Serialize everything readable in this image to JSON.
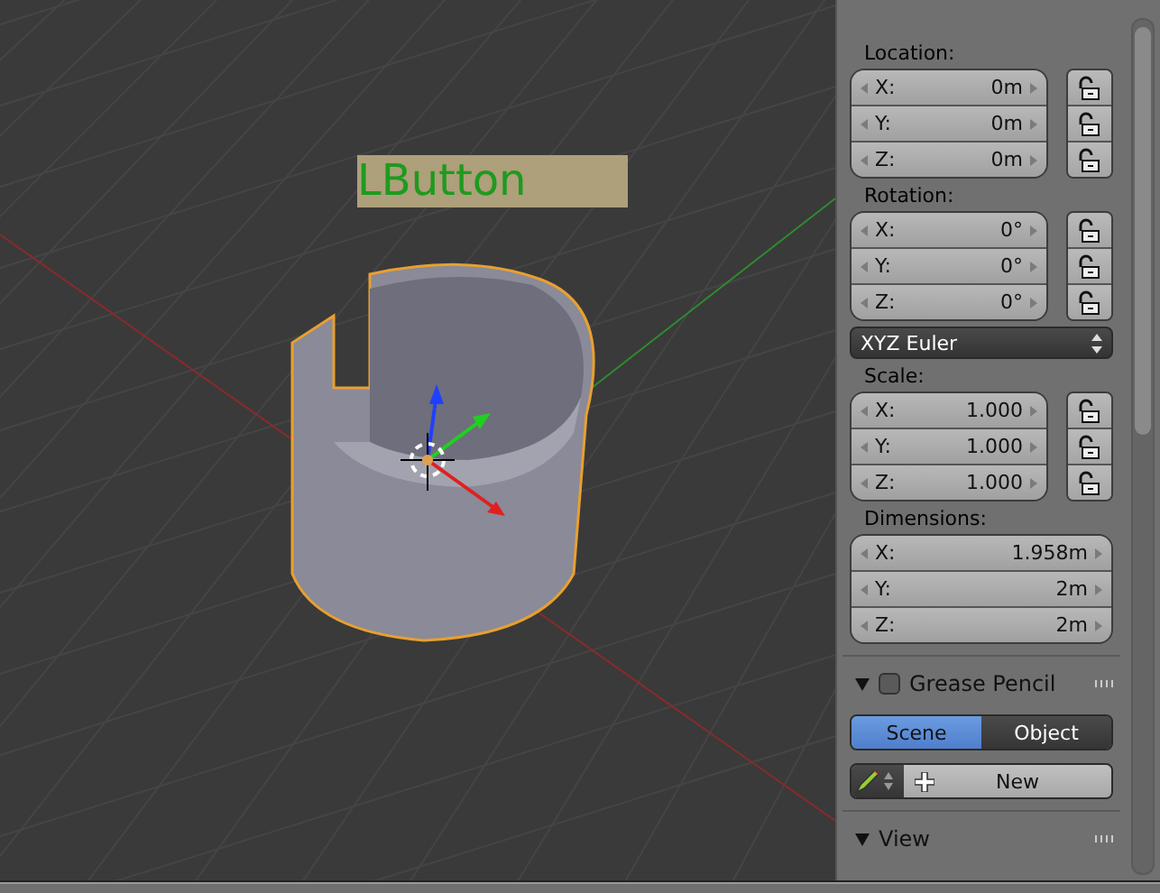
{
  "viewport": {
    "overlay_label": "LButton"
  },
  "transform": {
    "sections": [
      {
        "title": "Location:",
        "fields": [
          {
            "axis": "X:",
            "value": "0m",
            "locked": false
          },
          {
            "axis": "Y:",
            "value": "0m",
            "locked": false
          },
          {
            "axis": "Z:",
            "value": "0m",
            "locked": false
          }
        ]
      },
      {
        "title": "Rotation:",
        "fields": [
          {
            "axis": "X:",
            "value": "0°",
            "locked": false
          },
          {
            "axis": "Y:",
            "value": "0°",
            "locked": false
          },
          {
            "axis": "Z:",
            "value": "0°",
            "locked": false
          }
        ],
        "mode": "XYZ Euler"
      },
      {
        "title": "Scale:",
        "fields": [
          {
            "axis": "X:",
            "value": "1.000",
            "locked": false
          },
          {
            "axis": "Y:",
            "value": "1.000",
            "locked": false
          },
          {
            "axis": "Z:",
            "value": "1.000",
            "locked": false
          }
        ]
      },
      {
        "title": "Dimensions:",
        "fields": [
          {
            "axis": "X:",
            "value": "1.958m"
          },
          {
            "axis": "Y:",
            "value": "2m"
          },
          {
            "axis": "Z:",
            "value": "2m"
          }
        ]
      }
    ]
  },
  "grease_pencil": {
    "title": "Grease Pencil",
    "expanded": true,
    "checked": false,
    "tabs": [
      {
        "label": "Scene",
        "selected": true
      },
      {
        "label": "Object",
        "selected": false
      }
    ],
    "new_button": "New"
  },
  "view_panel": {
    "title": "View",
    "expanded": true
  }
}
